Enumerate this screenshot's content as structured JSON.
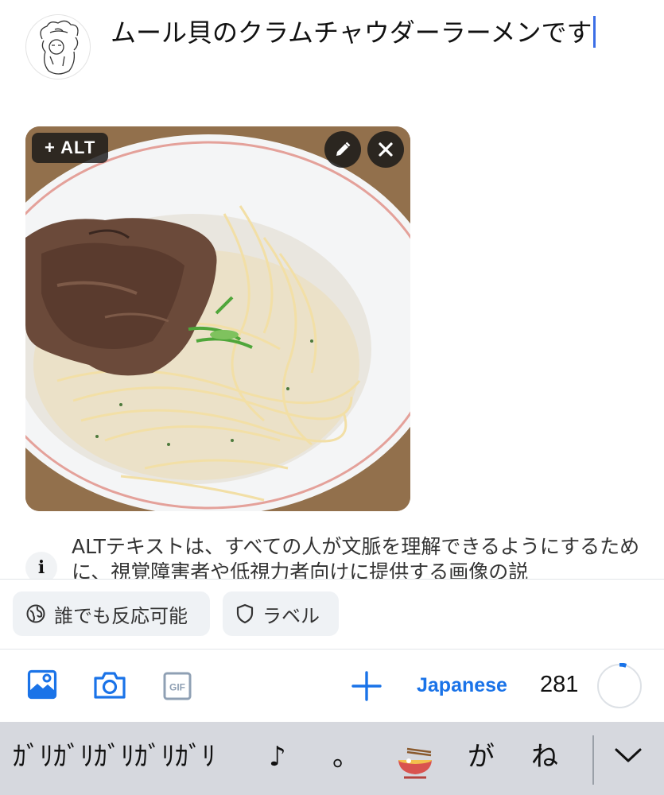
{
  "post": {
    "text": "ムール貝のクラムチャウダーラーメンです"
  },
  "image": {
    "alt_button_label": "+ ALT"
  },
  "alt_info": {
    "text": "ALTテキストは、すべての人が文脈を理解できるようにするために、視覚障害者や低視力者向けに提供する画像の説"
  },
  "chips": {
    "reply_label": "誰でも反応可能",
    "label_label": "ラベル"
  },
  "toolbar": {
    "language": "Japanese",
    "char_count": "281",
    "char_progress": 0.05
  },
  "keyboard": {
    "candidates": [
      "ｶﾞﾘｶﾞﾘｶﾞﾘｶﾞﾘｶﾞﾘ",
      "♪",
      "。",
      "🍜",
      "が",
      "ね"
    ]
  },
  "colors": {
    "accent": "#1a73e8",
    "caret": "#3b6ee6"
  }
}
